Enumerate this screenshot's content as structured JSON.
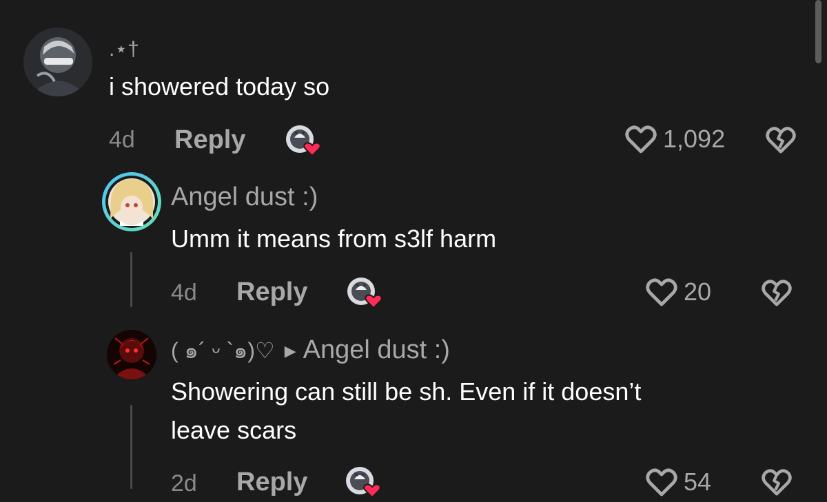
{
  "colors": {
    "background": "#1b1b1b",
    "text_primary": "#ffffff",
    "text_secondary": "#a8a8a8",
    "creator_heart": "#fe2c55",
    "story_ring_start": "#4fc3f7",
    "story_ring_end": "#66e0b3"
  },
  "comments": [
    {
      "username": ".⋆†",
      "text": "i showered today so",
      "time": "4d",
      "reply_label": "Reply",
      "likes": "1,092",
      "liked_by_creator": true
    },
    {
      "username": "Angel dust :)",
      "text": "Umm it means from s3lf harm",
      "time": "4d",
      "reply_label": "Reply",
      "likes": "20",
      "liked_by_creator": true,
      "has_story_ring": true
    },
    {
      "username": "( ๑´ ᵕ `๑)♡",
      "replying_to": "Angel dust :)",
      "text_line1": "Showering can still be sh. Even if it doesn’t",
      "text_line2": "leave scars",
      "time": "2d",
      "reply_label": "Reply",
      "likes": "54",
      "liked_by_creator": true
    }
  ],
  "icons": {
    "like": "heart-outline-icon",
    "dislike": "broken-heart-icon",
    "creator_like": "creator-heart-badge-icon",
    "reply_arrow": "reply-arrow-icon"
  }
}
